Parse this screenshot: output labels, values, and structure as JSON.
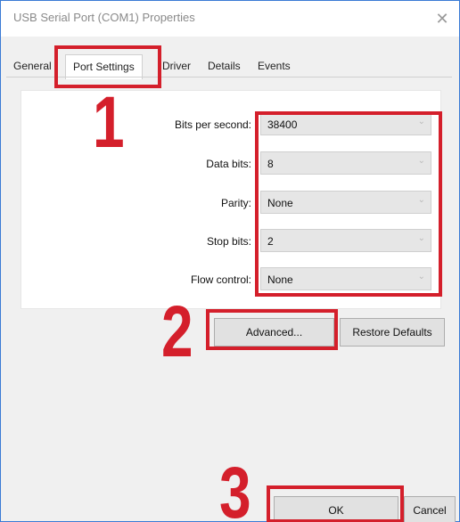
{
  "window": {
    "title": "USB Serial Port (COM1) Properties"
  },
  "tabs": [
    {
      "label": "General"
    },
    {
      "label": "Port Settings",
      "active": true
    },
    {
      "label": "Driver"
    },
    {
      "label": "Details"
    },
    {
      "label": "Events"
    }
  ],
  "settings": [
    {
      "label": "Bits per second:",
      "value": "38400"
    },
    {
      "label": "Data bits:",
      "value": "8"
    },
    {
      "label": "Parity:",
      "value": "None"
    },
    {
      "label": "Stop bits:",
      "value": "2"
    },
    {
      "label": "Flow control:",
      "value": "None"
    }
  ],
  "buttons": {
    "advanced": "Advanced...",
    "restore_defaults": "Restore Defaults",
    "ok": "OK",
    "cancel": "Cancel"
  },
  "annotations": {
    "step1": "1",
    "step2": "2",
    "step3": "3",
    "color": "#d41f2b"
  },
  "icons": {
    "close": "close-icon",
    "dropdown": "chevron-down-icon"
  }
}
